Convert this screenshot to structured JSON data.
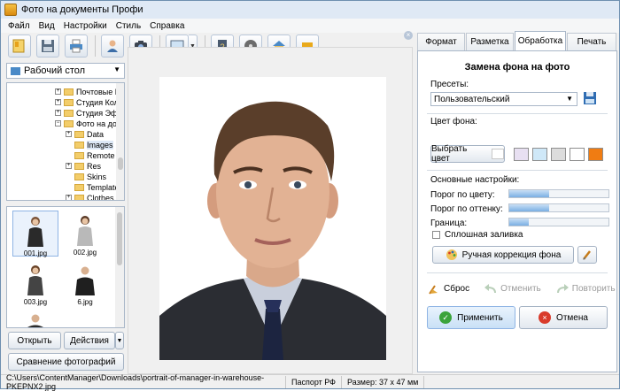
{
  "window": {
    "title": "Фото на документы Профи"
  },
  "menu": [
    "Файл",
    "Вид",
    "Настройки",
    "Стиль",
    "Справка"
  ],
  "toolbar": {
    "buttons": [
      "wizard-icon",
      "save-icon",
      "print-icon",
      "user-icon",
      "camera-icon",
      "monitor-icon",
      "help-book-icon",
      "film-icon",
      "house-icon",
      "cart-icon"
    ],
    "close_symbol": "×"
  },
  "left": {
    "folder_select": "Рабочий стол",
    "tree": [
      {
        "label": "Почтовые К",
        "exp": "+"
      },
      {
        "label": "Студия Колл",
        "exp": "+"
      },
      {
        "label": "Студия Эфф",
        "exp": "+"
      },
      {
        "label": "Фото на док",
        "exp": "−"
      },
      {
        "label": "Data",
        "exp": "+"
      },
      {
        "label": "Images",
        "exp": ""
      },
      {
        "label": "Remote",
        "exp": ""
      },
      {
        "label": "Res",
        "exp": "+"
      },
      {
        "label": "Skins",
        "exp": ""
      },
      {
        "label": "Template",
        "exp": ""
      },
      {
        "label": "Clothes",
        "exp": "+"
      }
    ],
    "thumbnails": [
      "001.jpg",
      "002.jpg",
      "003.jpg",
      "6.jpg"
    ],
    "open_label": "Открыть",
    "actions_label": "Действия",
    "compare_label": "Сравнение фотографий"
  },
  "tabs": [
    "Формат",
    "Разметка",
    "Обработка",
    "Печать"
  ],
  "panel": {
    "title": "Замена фона на фото",
    "presets_label": "Пресеты:",
    "preset_value": "Пользовательский",
    "bg_color_label": "Цвет фона:",
    "pick_color_label": "Выбрать цвет",
    "swatches": [
      "#e8e0f2",
      "#cfe8f8",
      "#dcdcdc",
      "#ffffff",
      "#f07c12"
    ],
    "basic_settings_label": "Основные настройки:",
    "sliders": [
      {
        "label": "Порог по цвету:",
        "value": 40
      },
      {
        "label": "Порог по оттенку:",
        "value": 40
      },
      {
        "label": "Граница:",
        "value": 20
      }
    ],
    "solid_fill_label": "Сплошная заливка",
    "manual_correction_label": "Ручная коррекция фона",
    "reset_label": "Сброс",
    "undo_label": "Отменить",
    "redo_label": "Повторить",
    "apply_label": "Применить",
    "cancel_label": "Отмена"
  },
  "status": {
    "path": "C:\\Users\\ContentManager\\Downloads\\portrait-of-manager-in-warehouse-PKEPNX2.jpg",
    "format": "Паспорт РФ",
    "size": "Размер: 37 x 47 мм"
  },
  "colors": {
    "accent": "#4a8ac7",
    "selection": "#dde8f6",
    "orange": "#f07c12"
  }
}
